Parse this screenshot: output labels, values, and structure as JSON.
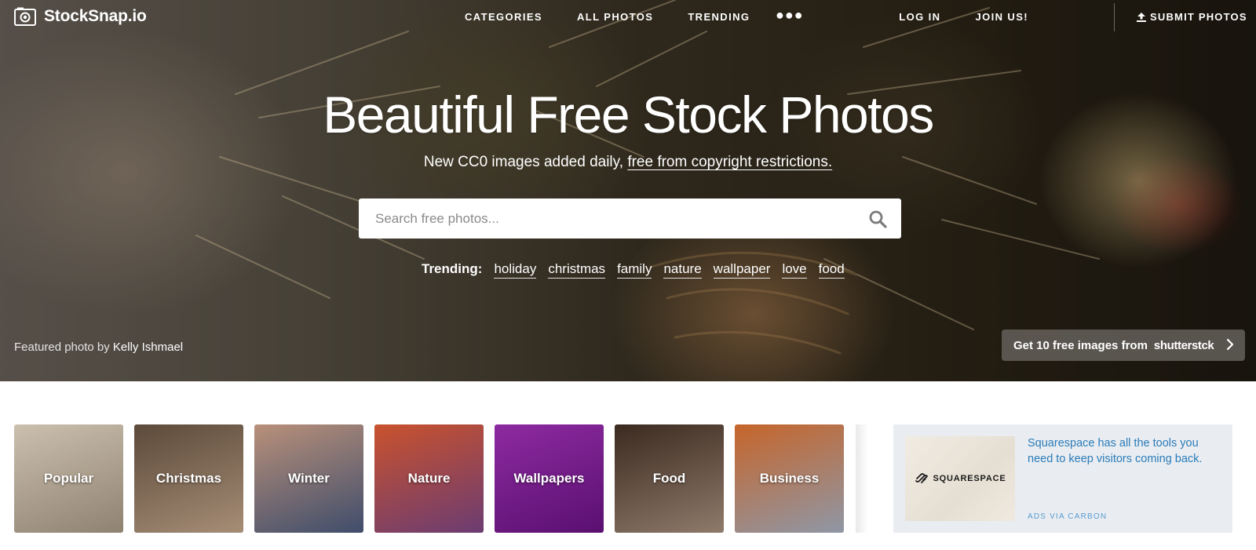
{
  "brand": {
    "name": "StockSnap.io",
    "logo_icon": "camera-icon"
  },
  "nav": {
    "center": [
      {
        "label": "CATEGORIES"
      },
      {
        "label": "ALL PHOTOS"
      },
      {
        "label": "TRENDING"
      }
    ],
    "more_label": "●●●",
    "login": "LOG IN",
    "join": "JOIN US!",
    "submit": "SUBMIT PHOTOS",
    "submit_icon": "upload-icon"
  },
  "hero": {
    "title": "Beautiful Free Stock Photos",
    "subtitle_prefix": "New CC0 images added daily, ",
    "subtitle_link": "free from copyright restrictions.",
    "search_placeholder": "Search free photos...",
    "search_icon": "magnifier-icon",
    "trending_label": "Trending:",
    "trending_tags": [
      "holiday",
      "christmas",
      "family",
      "nature",
      "wallpaper",
      "love",
      "food"
    ],
    "featured_prefix": "Featured photo by ",
    "featured_author": "Kelly Ishmael",
    "promo_text": "Get 10 free images from",
    "promo_brand": "shutterstck",
    "promo_icon": "chevron-right-icon"
  },
  "categories": [
    {
      "label": "Popular",
      "colors": [
        "#cbbfae",
        "#8f8271"
      ]
    },
    {
      "label": "Christmas",
      "colors": [
        "#5c4a3a",
        "#a68d76"
      ]
    },
    {
      "label": "Winter",
      "colors": [
        "#b9907a",
        "#3f4d6b"
      ]
    },
    {
      "label": "Nature",
      "colors": [
        "#c9522d",
        "#6b3c72"
      ]
    },
    {
      "label": "Wallpapers",
      "colors": [
        "#8d2aa1",
        "#5a1070"
      ]
    },
    {
      "label": "Food",
      "colors": [
        "#3b2a20",
        "#8f7a6a"
      ]
    },
    {
      "label": "Business",
      "colors": [
        "#c6652a",
        "#8f97a6"
      ]
    }
  ],
  "ad": {
    "brand_word": "SQUARESPACE",
    "brand_icon": "squarespace-logo-icon",
    "text": "Squarespace has all the tools you need to keep visitors coming back.",
    "via": "ADS VIA CARBON"
  },
  "colors": {
    "ad_link": "#2b7bb9",
    "ad_bg": "#e9edf1",
    "search_bg": "#ffffff"
  }
}
